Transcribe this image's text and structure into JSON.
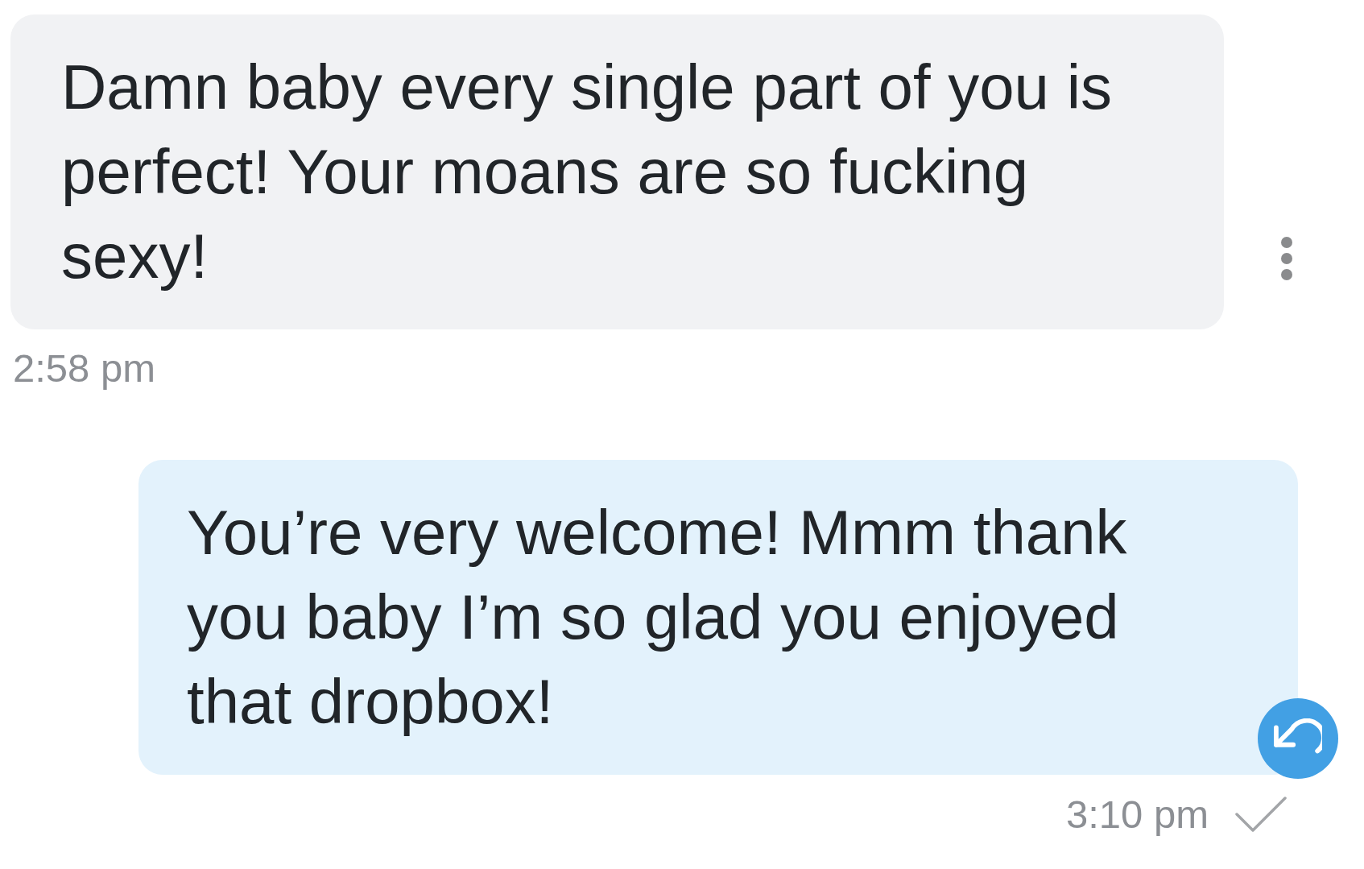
{
  "messages": [
    {
      "kind": "received",
      "text": "Damn baby every single part of you is perfect! Your moans are so fucking sexy!",
      "time": "2:58 pm"
    },
    {
      "kind": "sent",
      "text": "You’re very welcome! Mmm thank you baby I’m so glad you enjoyed that dropbox!",
      "time": "3:10 pm"
    }
  ]
}
